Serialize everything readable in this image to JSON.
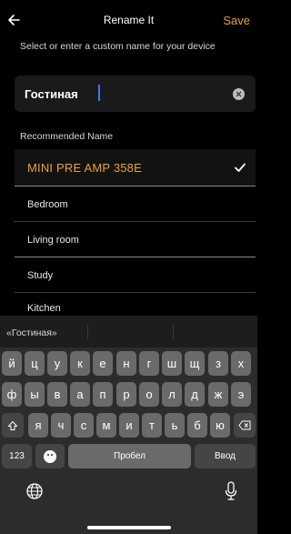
{
  "header": {
    "title": "Rename It",
    "save_label": "Save",
    "back_icon": "back-arrow-icon"
  },
  "hint": "Select or enter a custom name for your device",
  "name_input": {
    "value": "Гостиная"
  },
  "recommended": {
    "label": "Recommended Name",
    "items": [
      "MINI PRE AMP 358E",
      "Bedroom",
      "Living room",
      "Study",
      "Kitchen"
    ],
    "selected_index": 0
  },
  "keyboard": {
    "suggestion": "«Гостиная»",
    "row1": [
      "й",
      "ц",
      "у",
      "к",
      "е",
      "н",
      "г",
      "ш",
      "щ",
      "з",
      "х"
    ],
    "row2": [
      "ф",
      "ы",
      "в",
      "а",
      "п",
      "р",
      "о",
      "л",
      "д",
      "ж",
      "э"
    ],
    "row3": [
      "я",
      "ч",
      "с",
      "м",
      "и",
      "т",
      "ь",
      "б",
      "ю"
    ],
    "numbers_label": "123",
    "space_label": "Пробел",
    "return_label": "Ввод"
  },
  "colors": {
    "accent": "#e8a23a",
    "background": "#000000"
  }
}
